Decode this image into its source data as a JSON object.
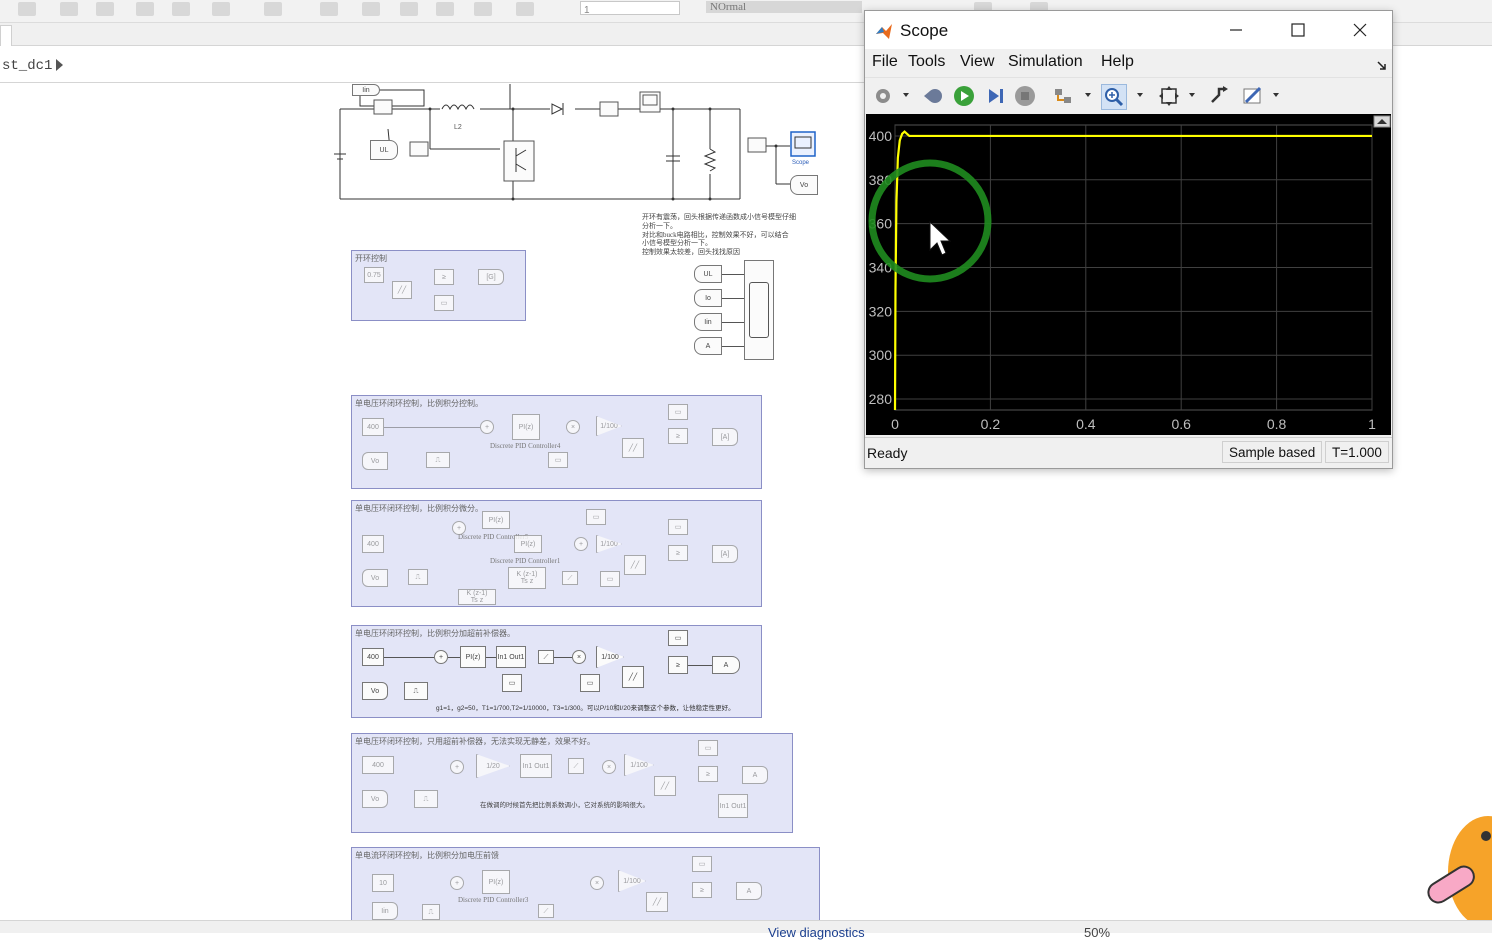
{
  "main": {
    "toolbar": {
      "model_field_value": "1",
      "mode_field_value": "NOrmal"
    },
    "breadcrumb": {
      "model": "st_dc1"
    },
    "status": {
      "view_label": "View diagnostics",
      "zoom": "50%"
    },
    "circuit": {
      "labels": {
        "iin": "Iin",
        "ul": "UL",
        "l2": "L2",
        "scope": "Scope",
        "vo": "Vo"
      }
    },
    "note_lines": [
      "开环有震荡，回头根据传递函数成小信号模型仔细",
      "分析一下。",
      "对比和buck电路相比，控制效果不好，可以结合",
      "小信号模型分析一下。",
      "控制效果太较差，回头找找原因"
    ],
    "goto_tags": [
      "UL",
      "Io",
      "Iin",
      "A"
    ],
    "subsystems": [
      {
        "caption": "开环控制",
        "blocks": [
          "0.75"
        ]
      },
      {
        "caption": "单电压环闭环控制，比例积分控制。",
        "blocks": [
          "400",
          "Vo",
          "PI(z)",
          "Discrete PID Controller4",
          "1/100"
        ]
      },
      {
        "caption": "单电压环闭环控制，比例积分微分。",
        "blocks": [
          "400",
          "Vo",
          "PI(z)",
          "Discrete PID Controller5",
          "PI(z)",
          "Discrete PID Controller1",
          "K (z-1)",
          "Ts z",
          "K (z-1)",
          "Ts z",
          "1/100"
        ]
      },
      {
        "caption": "单电压环闭环控制，比例积分加超前补偿器。",
        "blocks": [
          "400",
          "Vo",
          "PI(z)",
          "In1 Out1",
          "1/100",
          "A"
        ],
        "note": "g1=1，g2=50，T1=1/700,T2=1/10000，T3=1/300。可以P/10和I/20来调整这个参数，让他稳定性更好。"
      },
      {
        "caption": "单电压环闭环控制，只用超前补偿器，无法实现无静差，效果不好。",
        "blocks": [
          "400",
          "Vo",
          "1/20",
          "In1 Out1",
          "1/100",
          "A",
          "In1 Out1"
        ],
        "note": "在做调的时候首先把比例系数调小，它对系统的影响很大。"
      },
      {
        "caption": "单电流环闭环控制，比例积分加电压前馈",
        "blocks": [
          "10",
          "Iin",
          "PI(z)",
          "Discrete PID Controller3",
          "1/100",
          "A"
        ]
      }
    ]
  },
  "scope": {
    "title": "Scope",
    "menu": [
      "File",
      "Tools",
      "View",
      "Simulation",
      "Help"
    ],
    "toolbar_icons": [
      "gear-icon",
      "restore-icon",
      "run-icon",
      "step-forward-icon",
      "stop-icon",
      "highlight-icon",
      "zoom-icon",
      "fit-icon",
      "cursor-icon",
      "measure-icon"
    ],
    "status": {
      "ready": "Ready",
      "sample_mode": "Sample based",
      "time": "T=1.000"
    },
    "colors": {
      "background": "#000000",
      "grid": "#404040",
      "trace": "#ffff00",
      "axis_text": "#bfbfbf",
      "cursor_ring": "#1f8c1f"
    }
  },
  "chart_data": {
    "type": "line",
    "title": "",
    "xlabel": "",
    "ylabel": "",
    "xlim": [
      0,
      1
    ],
    "ylim": [
      275,
      405
    ],
    "x_ticks": [
      "0",
      "0.2",
      "0.4",
      "0.6",
      "0.8",
      "1"
    ],
    "y_ticks": [
      "280",
      "300",
      "320",
      "340",
      "360",
      "380",
      "400"
    ],
    "grid": true,
    "series": [
      {
        "x": [
          0.0,
          0.001,
          0.003,
          0.006,
          0.01,
          0.015,
          0.02,
          0.03,
          0.05,
          0.1,
          0.2,
          0.4,
          0.6,
          0.8,
          1.0
        ],
        "y": [
          275,
          330,
          370,
          390,
          398,
          401,
          402,
          400,
          400,
          400,
          400,
          400,
          400,
          400,
          400
        ]
      }
    ]
  }
}
